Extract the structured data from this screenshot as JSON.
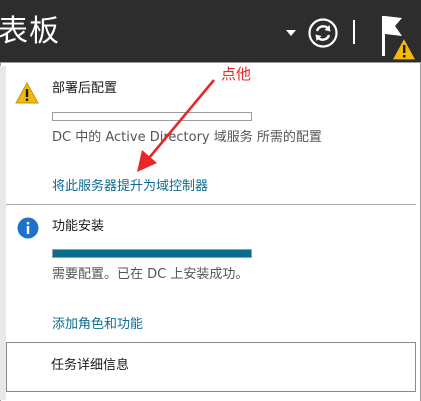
{
  "header": {
    "title": "表板",
    "icons": [
      "dropdown-arrow-icon",
      "refresh-icon",
      "notification-flag-icon",
      "warning-icon"
    ]
  },
  "annotation": {
    "text": "点他",
    "color": "#e62828"
  },
  "post_deployment": {
    "title": "部署后配置",
    "progress": 0,
    "description": "DC 中的 Active Directory 域服务 所需的配置",
    "link": "将此服务器提升为域控制器",
    "icon": "warning-icon"
  },
  "feature_install": {
    "title": "功能安装",
    "progress": 1.0,
    "description": "需要配置。已在 DC 上安装成功。",
    "link": "添加角色和功能",
    "icon": "info-icon"
  },
  "task_details": {
    "label": "任务详细信息"
  },
  "colors": {
    "header_bg": "#2d2d2d",
    "link": "#0f6b8f",
    "progress_fill": "#0a6b8c",
    "warning": "#f2b90d",
    "info": "#1e73c8"
  }
}
